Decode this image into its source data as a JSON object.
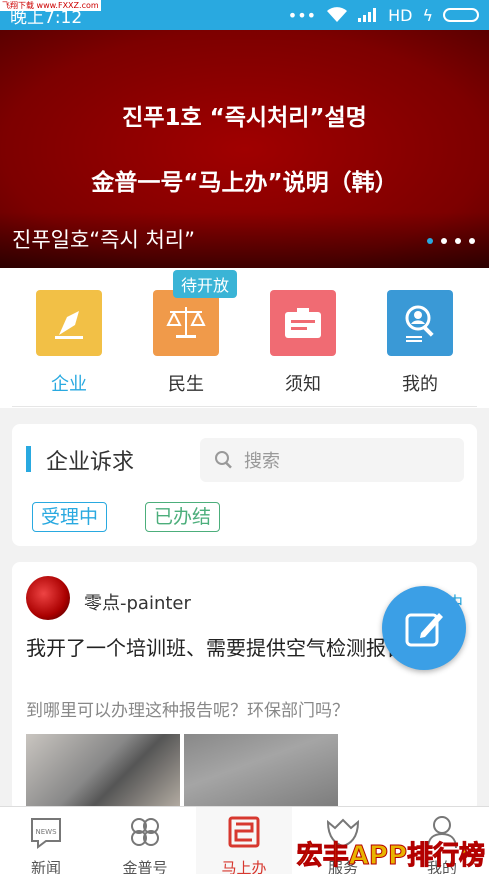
{
  "watermark_top": "飞翔下载 www.FXXZ.com",
  "status_bar": {
    "time": "晚上7:12",
    "network": "HD"
  },
  "banner": {
    "line1": "진푸1호 “즉시처리”설명",
    "line2": "金普一号“马上办”说明（韩）",
    "caption": "진푸일호“즉시 처리”",
    "page_count": 4,
    "active_index": 0
  },
  "grid": {
    "badge": "待开放",
    "items": [
      {
        "label": "企业",
        "icon": "pen-icon",
        "color": "#f2c046",
        "active": true
      },
      {
        "label": "民生",
        "icon": "scales-icon",
        "color": "#f09a4a",
        "active": false
      },
      {
        "label": "须知",
        "icon": "notice-card-icon",
        "color": "#f06b73",
        "active": false
      },
      {
        "label": "我的",
        "icon": "profile-search-icon",
        "color": "#3a99d6",
        "active": false
      }
    ]
  },
  "requests": {
    "title": "企业诉求",
    "search_placeholder": "搜索",
    "tag_processing": "受理中",
    "tag_done": "已办结"
  },
  "post": {
    "author": "零点-painter",
    "status": "中",
    "title": "我开了一个培训班、需要提供空气检测报告。",
    "description": "到哪里可以办理这种报告呢？环保部门吗？"
  },
  "nav": {
    "items": [
      {
        "label": "新闻",
        "icon": "news-icon",
        "active": false
      },
      {
        "label": "金普号",
        "icon": "clover-icon",
        "active": false
      },
      {
        "label": "马上办",
        "icon": "seal-icon",
        "active": true
      },
      {
        "label": "服务",
        "icon": "service-hands-icon",
        "active": false
      },
      {
        "label": "我的",
        "icon": "person-icon",
        "active": false
      }
    ]
  },
  "watermark_bottom": "宏丰APP排行榜"
}
